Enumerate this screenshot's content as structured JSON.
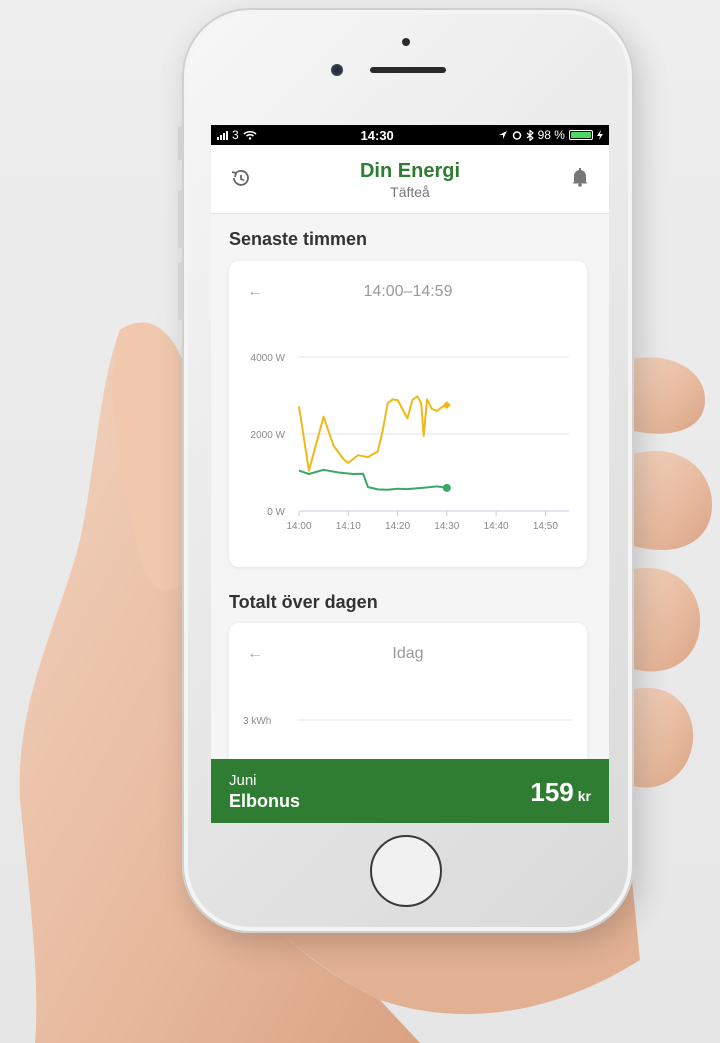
{
  "status_bar": {
    "carrier": "3",
    "time": "14:30",
    "battery_percent": "98 %"
  },
  "header": {
    "title": "Din Energi",
    "subtitle": "Täfteå"
  },
  "hourly": {
    "section_title": "Senaste timmen",
    "range_label": "14:00–14:59",
    "back_arrow": "←"
  },
  "daily": {
    "section_title": "Totalt över dagen",
    "range_label": "Idag",
    "back_arrow": "←",
    "y_tick": "3 kWh"
  },
  "bonus_bar": {
    "month": "Juni",
    "label": "Elbonus",
    "amount": "159",
    "unit": "kr"
  },
  "colors": {
    "brand_green": "#2e7d32",
    "series_yellow": "#f2b81a",
    "series_green": "#3aa868"
  },
  "chart_data": {
    "type": "line",
    "title": "14:00–14:59",
    "xlabel": "",
    "ylabel": "",
    "x_ticks": [
      "14:00",
      "14:10",
      "14:20",
      "14:30",
      "14:40",
      "14:50"
    ],
    "y_ticks": [
      "0 W",
      "2000 W",
      "4000 W"
    ],
    "xlim": [
      0,
      59
    ],
    "ylim": [
      0,
      4000
    ],
    "grid": true,
    "series": [
      {
        "color": "#f2b81a",
        "x": [
          0,
          2,
          5,
          7,
          9,
          10,
          12,
          14,
          16,
          17,
          18,
          19,
          20,
          21,
          22,
          23,
          24,
          24.8,
          25.3,
          26,
          27,
          28,
          29,
          30
        ],
        "y": [
          2720,
          1050,
          2450,
          1700,
          1350,
          1250,
          1450,
          1400,
          1550,
          2100,
          2800,
          2900,
          2880,
          2650,
          2400,
          2880,
          2980,
          2800,
          1950,
          2900,
          2650,
          2600,
          2700,
          2750
        ]
      },
      {
        "color": "#3aa868",
        "x": [
          0,
          2,
          5,
          8,
          11,
          13,
          14,
          16,
          18,
          20,
          22,
          25,
          28,
          30
        ],
        "y": [
          1050,
          960,
          1070,
          1000,
          960,
          970,
          620,
          560,
          550,
          580,
          570,
          600,
          640,
          600
        ]
      }
    ]
  }
}
